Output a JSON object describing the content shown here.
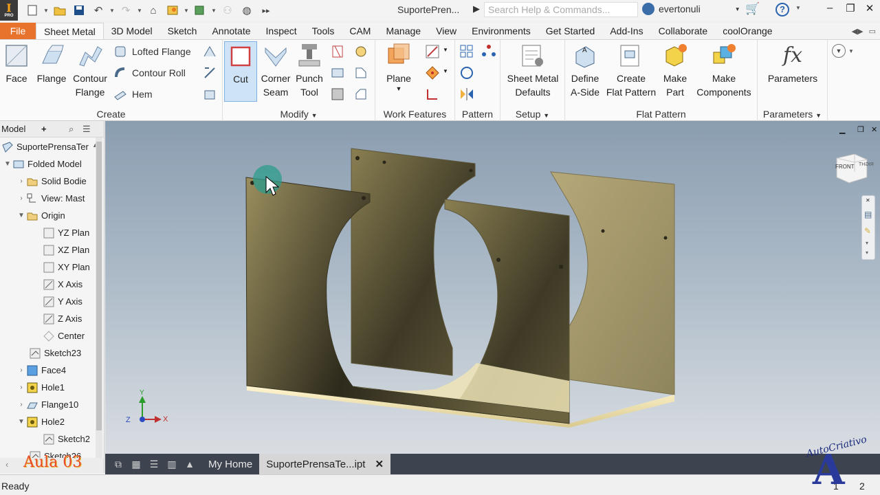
{
  "app": {
    "logo": "I",
    "logo_sub": "PRO",
    "document_title": "SuportePren...",
    "search_placeholder": "Search Help & Commands...",
    "username": "evertonuli"
  },
  "ribbon_tabs": [
    {
      "label": "File"
    },
    {
      "label": "Sheet Metal"
    },
    {
      "label": "3D Model"
    },
    {
      "label": "Sketch"
    },
    {
      "label": "Annotate"
    },
    {
      "label": "Inspect"
    },
    {
      "label": "Tools"
    },
    {
      "label": "CAM"
    },
    {
      "label": "Manage"
    },
    {
      "label": "View"
    },
    {
      "label": "Environments"
    },
    {
      "label": "Get Started"
    },
    {
      "label": "Add-Ins"
    },
    {
      "label": "Collaborate"
    },
    {
      "label": "coolOrange"
    }
  ],
  "ribbon": {
    "create": {
      "label": "Create",
      "face": "Face",
      "flange": "Flange",
      "contour_flange_1": "Contour",
      "contour_flange_2": "Flange",
      "lofted_flange": "Lofted Flange",
      "contour_roll": "Contour Roll",
      "hem": "Hem"
    },
    "modify": {
      "label": "Modify",
      "cut": "Cut",
      "corner_seam_1": "Corner",
      "corner_seam_2": "Seam",
      "punch_tool_1": "Punch",
      "punch_tool_2": "Tool"
    },
    "work_features": {
      "label": "Work Features",
      "plane": "Plane"
    },
    "pattern": {
      "label": "Pattern"
    },
    "setup": {
      "label": "Setup",
      "defaults_1": "Sheet Metal",
      "defaults_2": "Defaults"
    },
    "flat_pattern": {
      "label": "Flat Pattern",
      "define_1": "Define",
      "define_2": "A-Side",
      "create_1": "Create",
      "create_2": "Flat Pattern",
      "make_part_1": "Make",
      "make_part_2": "Part",
      "make_comp_1": "Make",
      "make_comp_2": "Components"
    },
    "parameters": {
      "label": "Parameters",
      "button": "Parameters",
      "fx": "fx"
    }
  },
  "browser": {
    "title": "Model",
    "plus": "+",
    "items": [
      {
        "label": "SuportePrensaTer"
      },
      {
        "label": "Folded Model"
      },
      {
        "label": "Solid Bodie"
      },
      {
        "label": "View: Mast"
      },
      {
        "label": "Origin"
      },
      {
        "label": "YZ Plan"
      },
      {
        "label": "XZ Plan"
      },
      {
        "label": "XY Plan"
      },
      {
        "label": "X Axis"
      },
      {
        "label": "Y Axis"
      },
      {
        "label": "Z Axis"
      },
      {
        "label": "Center"
      },
      {
        "label": "Sketch23"
      },
      {
        "label": "Face4"
      },
      {
        "label": "Hole1"
      },
      {
        "label": "Flange10"
      },
      {
        "label": "Hole2"
      },
      {
        "label": "Sketch2"
      },
      {
        "label": "Sketch26"
      }
    ]
  },
  "viewcube": {
    "front": "FRONT",
    "right": "RIGHT"
  },
  "triad": {
    "x": "X",
    "y": "Y",
    "z": "Z"
  },
  "doc_tabs": {
    "home": "My Home",
    "active": "SuportePrensaTe...ipt"
  },
  "status": {
    "text": "Ready",
    "count1": "1",
    "count2": "2"
  },
  "watermarks": {
    "lesson": "Aula 03",
    "brand": "AutoCriativo",
    "brand_letter": "A"
  },
  "colors": {
    "accent": "#e8732c",
    "part": "#b5a879",
    "viewport_top": "#8a9db0",
    "doctab_bar": "#3d4450"
  }
}
